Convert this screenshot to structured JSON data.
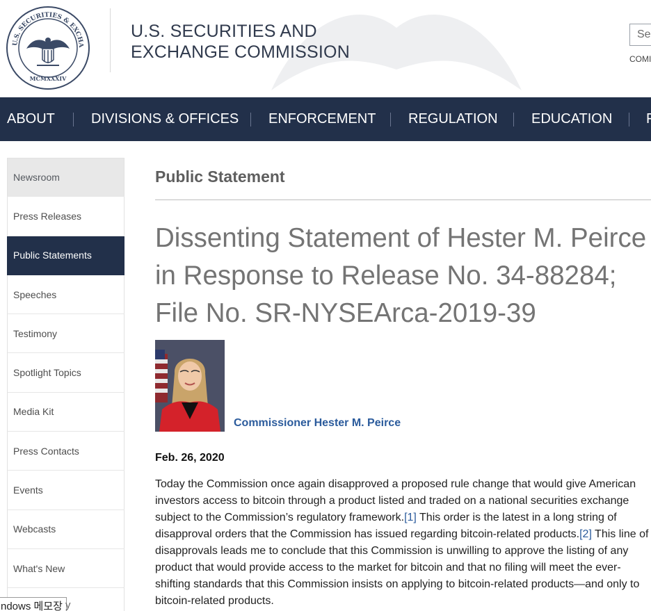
{
  "header": {
    "agency_line1": "U.S. SECURITIES AND",
    "agency_line2": "EXCHANGE COMMISSION",
    "search_placeholder": "Se",
    "commission_link": "COMI",
    "seal_lettering": "U.S. SECURITIES AND EXCHANGE COMMISSION MCMXXXIV"
  },
  "nav": {
    "items": [
      "ABOUT",
      "DIVISIONS & OFFICES",
      "ENFORCEMENT",
      "REGULATION",
      "EDUCATION",
      "F"
    ]
  },
  "sidebar": {
    "items": [
      {
        "label": "Newsroom"
      },
      {
        "label": "Press Releases"
      },
      {
        "label": "Public Statements"
      },
      {
        "label": "Speeches"
      },
      {
        "label": "Testimony"
      },
      {
        "label": "Spotlight Topics"
      },
      {
        "label": "Media Kit"
      },
      {
        "label": "Press Contacts"
      },
      {
        "label": "Events"
      },
      {
        "label": "Webcasts"
      },
      {
        "label": "What's New"
      }
    ],
    "active_index": 2
  },
  "main": {
    "section_title": "Public Statement",
    "headline": "Dissenting Statement of Hester M. Peirce in Response to Release No. 34-88284; File No. SR-NYSEArca-2019-39",
    "author": "Commissioner Hester M. Peirce",
    "date": "Feb. 26, 2020",
    "body_part1": "Today the Commission once again disapproved a proposed rule change that would give American investors access to bitcoin through a product listed and traded on a national securities exchange subject to the Commission’s regulatory framework.",
    "footnote1": "[1]",
    "body_part2": " This order is the latest in a long string of disapproval orders that the Commission has issued regarding bitcoin-related products.",
    "footnote2": "[2]",
    "body_part3": " This line of disapprovals leads me to conclude that this Commission is unwilling to approve the listing of any product that would provide access to the market for bitcoin and that no filing will meet the ever-shifting standards that this Commission insists on applying to bitcoin-related products—and only to bitcoin-related products."
  },
  "taskbar": {
    "label": "ndows 메모장",
    "tail": "y"
  },
  "colors": {
    "nav_bg": "#22304a",
    "link": "#2b5b9c",
    "headline": "#747474"
  }
}
